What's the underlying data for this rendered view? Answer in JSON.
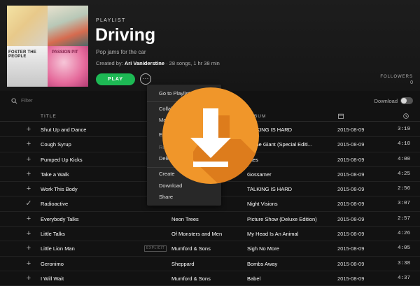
{
  "playlist": {
    "label": "PLAYLIST",
    "title": "Driving",
    "description": "Pop jams for the car",
    "created_by_prefix": "Created by:",
    "creator": "Ari Vaniderstine",
    "meta_suffix": "· 28 songs, 1 hr 38 min",
    "play_label": "PLAY",
    "more_label": "···",
    "followers_label": "FOLLOWERS",
    "followers_count": "0",
    "cover_texts": {
      "tile3": "FOSTER THE PEOPLE",
      "tile4": "PASSION PIT"
    }
  },
  "filter": {
    "placeholder": "Filter",
    "download_label": "Download"
  },
  "table": {
    "columns": {
      "title": "TITLE",
      "album": "ALBUM"
    },
    "rows": [
      {
        "icon": "+",
        "title": "Shut Up and Dance",
        "artist": "",
        "album": "TALKING IS HARD",
        "date": "2015-08-09",
        "duration": "3:19"
      },
      {
        "icon": "+",
        "title": "Cough Syrup",
        "artist": "",
        "album": "ng the Giant (Special Editi...",
        "date": "2015-08-09",
        "duration": "4:10"
      },
      {
        "icon": "+",
        "title": "Pumped Up Kicks",
        "artist": "",
        "album": "ches",
        "date": "2015-08-09",
        "duration": "4:00"
      },
      {
        "icon": "+",
        "title": "Take a Walk",
        "artist": "",
        "album": "Gossamer",
        "date": "2015-08-09",
        "duration": "4:25"
      },
      {
        "icon": "+",
        "title": "Work This Body",
        "artist": "",
        "album": "TALKING IS HARD",
        "date": "2015-08-09",
        "duration": "2:56"
      },
      {
        "icon": "✓",
        "title": "Radioactive",
        "artist": "",
        "album": "Night Visions",
        "date": "2015-08-09",
        "duration": "3:07"
      },
      {
        "icon": "+",
        "title": "Everybody Talks",
        "artist": "Neon Trees",
        "album": "Picture Show (Deluxe Edition)",
        "date": "2015-08-09",
        "duration": "2:57"
      },
      {
        "icon": "+",
        "title": "Little Talks",
        "artist": "Of Monsters and Men",
        "album": "My Head Is An Animal",
        "date": "2015-08-09",
        "duration": "4:26"
      },
      {
        "icon": "+",
        "title": "Little Lion Man",
        "artist": "Mumford & Sons",
        "album": "Sigh No More",
        "date": "2015-08-09",
        "duration": "4:05",
        "explicit": "EXPLICIT"
      },
      {
        "icon": "+",
        "title": "Geronimo",
        "artist": "Sheppard",
        "album": "Bombs Away",
        "date": "2015-08-09",
        "duration": "3:38"
      },
      {
        "icon": "+",
        "title": "I Will Wait",
        "artist": "Mumford & Sons",
        "album": "Babel",
        "date": "2015-08-09",
        "duration": "4:37"
      }
    ]
  },
  "context_menu": {
    "items": [
      {
        "label": "Go to Playlist Radio",
        "dim": false
      },
      {
        "label": "Collabora",
        "dim": false
      },
      {
        "label": "Make",
        "dim": false
      },
      {
        "label": "Edi",
        "dim": false
      },
      {
        "label": "Re",
        "dim": true
      },
      {
        "label": "Dele",
        "dim": false
      },
      {
        "label": "Create",
        "dim": false
      },
      {
        "label": "Download",
        "dim": false
      },
      {
        "label": "Share",
        "dim": false
      }
    ]
  },
  "overlay": {
    "icon": "download-icon",
    "color": "#f0962a"
  },
  "colors": {
    "accent": "#1db954",
    "background": "#121212",
    "menu": "#282828"
  }
}
